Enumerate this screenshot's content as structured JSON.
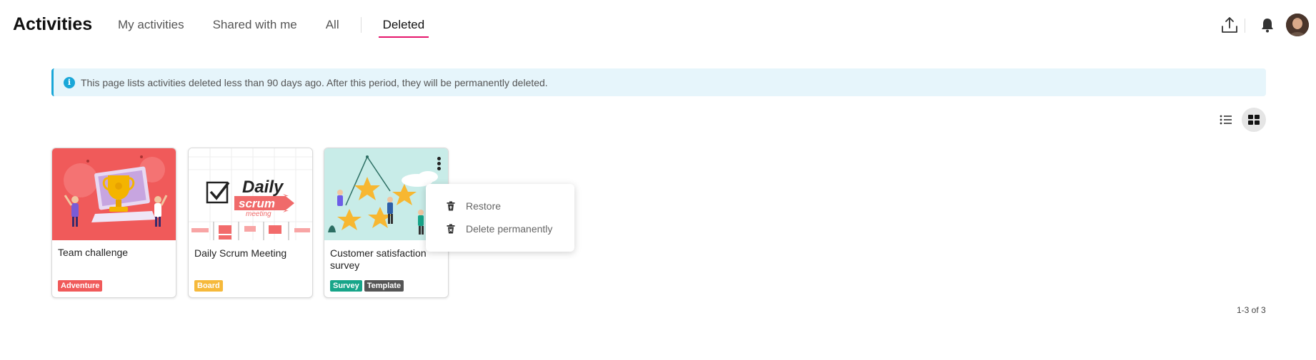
{
  "header": {
    "title": "Activities",
    "tabs": [
      {
        "label": "My activities"
      },
      {
        "label": "Shared with me"
      },
      {
        "label": "All"
      },
      {
        "label": "Deleted",
        "active": true
      }
    ],
    "icons": {
      "export": "export-icon",
      "notifications": "bell-icon",
      "avatar": "avatar"
    }
  },
  "banner": {
    "icon": "info-icon",
    "text": "This page lists activities deleted less than 90 days ago. After this period, they will be permanently deleted."
  },
  "view_toggle": {
    "list": "list-view-icon",
    "grid": "grid-view-icon",
    "selected": "grid"
  },
  "cards": [
    {
      "title": "Team challenge",
      "tags": [
        {
          "label": "Adventure",
          "color": "#f05a5a"
        }
      ]
    },
    {
      "title": "Daily Scrum Meeting",
      "thumb_title": [
        "Daily",
        "scrum",
        "meeting"
      ],
      "tags": [
        {
          "label": "Board",
          "color": "#f6b93b"
        }
      ]
    },
    {
      "title": "Customer satisfaction survey",
      "tags": [
        {
          "label": "Survey",
          "color": "#17a589"
        },
        {
          "label": "Template",
          "color": "#555555"
        }
      ]
    }
  ],
  "context_menu": {
    "items": [
      {
        "label": "Restore",
        "icon": "restore-icon"
      },
      {
        "label": "Delete permanently",
        "icon": "trash-icon"
      }
    ]
  },
  "pagination": {
    "text": "1-3 of 3"
  },
  "colors": {
    "accent": "#e5156b",
    "info": "#1aa7d8",
    "banner_bg": "#e6f5fb"
  }
}
